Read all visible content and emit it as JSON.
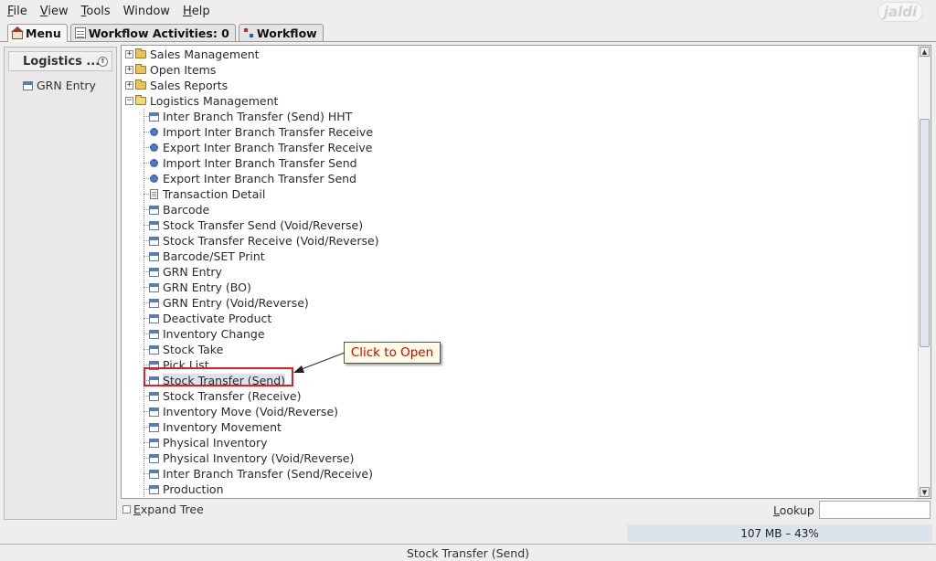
{
  "menubar": {
    "file": {
      "key": "F",
      "rest": "ile"
    },
    "view": {
      "key": "V",
      "rest": "iew"
    },
    "tools": {
      "key": "T",
      "rest": "ools"
    },
    "window": "Window",
    "help": {
      "key": "H",
      "rest": "elp"
    },
    "brand": "jaldi"
  },
  "tabs": {
    "menu": "Menu",
    "workflow_activities": "Workflow Activities: 0",
    "workflow": "Workflow"
  },
  "left_panel": {
    "header": "Logistics ...",
    "collapse_glyph": "⇑",
    "items": [
      {
        "label": "GRN Entry"
      }
    ]
  },
  "tree": {
    "folders": [
      {
        "label": "Sales Management",
        "expanded": false
      },
      {
        "label": "Open Items",
        "expanded": false
      },
      {
        "label": "Sales Reports",
        "expanded": false
      },
      {
        "label": "Logistics Management",
        "expanded": true
      }
    ],
    "children": [
      {
        "label": "Inter Branch Transfer (Send) HHT",
        "icon": "window-icon"
      },
      {
        "label": "Import Inter Branch Transfer Receive",
        "icon": "gear-icon"
      },
      {
        "label": "Export Inter Branch Transfer Receive",
        "icon": "gear-icon"
      },
      {
        "label": "Import Inter Branch Transfer Send",
        "icon": "gear-icon"
      },
      {
        "label": "Export Inter Branch Transfer Send",
        "icon": "gear-icon"
      },
      {
        "label": "Transaction Detail",
        "icon": "document-icon"
      },
      {
        "label": "Barcode",
        "icon": "window-icon"
      },
      {
        "label": "Stock Transfer Send (Void/Reverse)",
        "icon": "window-icon"
      },
      {
        "label": "Stock Transfer Receive (Void/Reverse)",
        "icon": "window-icon"
      },
      {
        "label": "Barcode/SET Print",
        "icon": "window-icon"
      },
      {
        "label": "GRN Entry",
        "icon": "window-icon"
      },
      {
        "label": "GRN Entry (BO)",
        "icon": "window-icon"
      },
      {
        "label": "GRN Entry (Void/Reverse)",
        "icon": "window-icon"
      },
      {
        "label": "Deactivate Product",
        "icon": "window-icon"
      },
      {
        "label": "Inventory Change",
        "icon": "window-icon"
      },
      {
        "label": "Stock Take",
        "icon": "window-icon"
      },
      {
        "label": "Pick List",
        "icon": "window-icon"
      },
      {
        "label": "Stock Transfer (Send)",
        "icon": "window-icon",
        "selected": true
      },
      {
        "label": "Stock Transfer (Receive)",
        "icon": "window-icon"
      },
      {
        "label": "Inventory Move (Void/Reverse)",
        "icon": "window-icon"
      },
      {
        "label": "Inventory Movement",
        "icon": "window-icon"
      },
      {
        "label": "Physical Inventory",
        "icon": "window-icon"
      },
      {
        "label": "Physical Inventory (Void/Reverse)",
        "icon": "window-icon"
      },
      {
        "label": "Inter Branch Transfer (Send/Receive)",
        "icon": "window-icon"
      },
      {
        "label": "Production",
        "icon": "window-icon"
      }
    ],
    "expand_glyph": "+",
    "collapse_glyph": "−"
  },
  "scrollbar": {
    "up": "▲",
    "down": "▼"
  },
  "annotation": {
    "callout": "Click to Open",
    "color": "#e02020"
  },
  "bottom": {
    "expand_tree": {
      "key": "E",
      "rest": "xpand Tree"
    },
    "lookup": {
      "key": "L",
      "rest": "ookup"
    },
    "lookup_value": "",
    "memory": "107 MB – 43%"
  },
  "statusbar": {
    "text": "Stock Transfer (Send)"
  }
}
